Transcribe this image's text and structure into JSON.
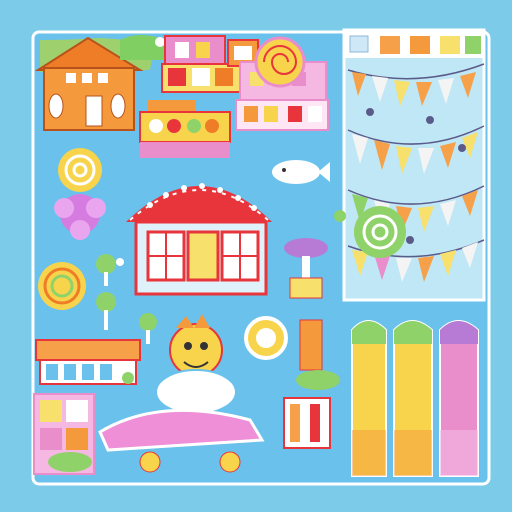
{
  "scene": {
    "colors": {
      "frame_bg": "#7ccbe9",
      "board_bg": "#69c1ec",
      "board_border": "#ffffff",
      "house_orange": "#f59a3c",
      "roof_orange": "#ef7d28",
      "roof_red": "#e8353b",
      "crayon_yellow": "#f7d44c",
      "crayon_pink": "#e98ecb",
      "crayon_green": "#8fd26a",
      "bunting_orange": "#f6a14a",
      "bunting_yellow": "#f7e06b",
      "bunting_white": "#f4f4f4",
      "sky_panel": "#bfe7f5",
      "skate_pink": "#ee8fd8",
      "outline": "#e8353b"
    },
    "icons": [
      "house-icon",
      "shop-icon",
      "swirl-icon",
      "bunting-icon",
      "crayon-icon",
      "character-icon",
      "tree-icon",
      "flower-icon"
    ]
  }
}
